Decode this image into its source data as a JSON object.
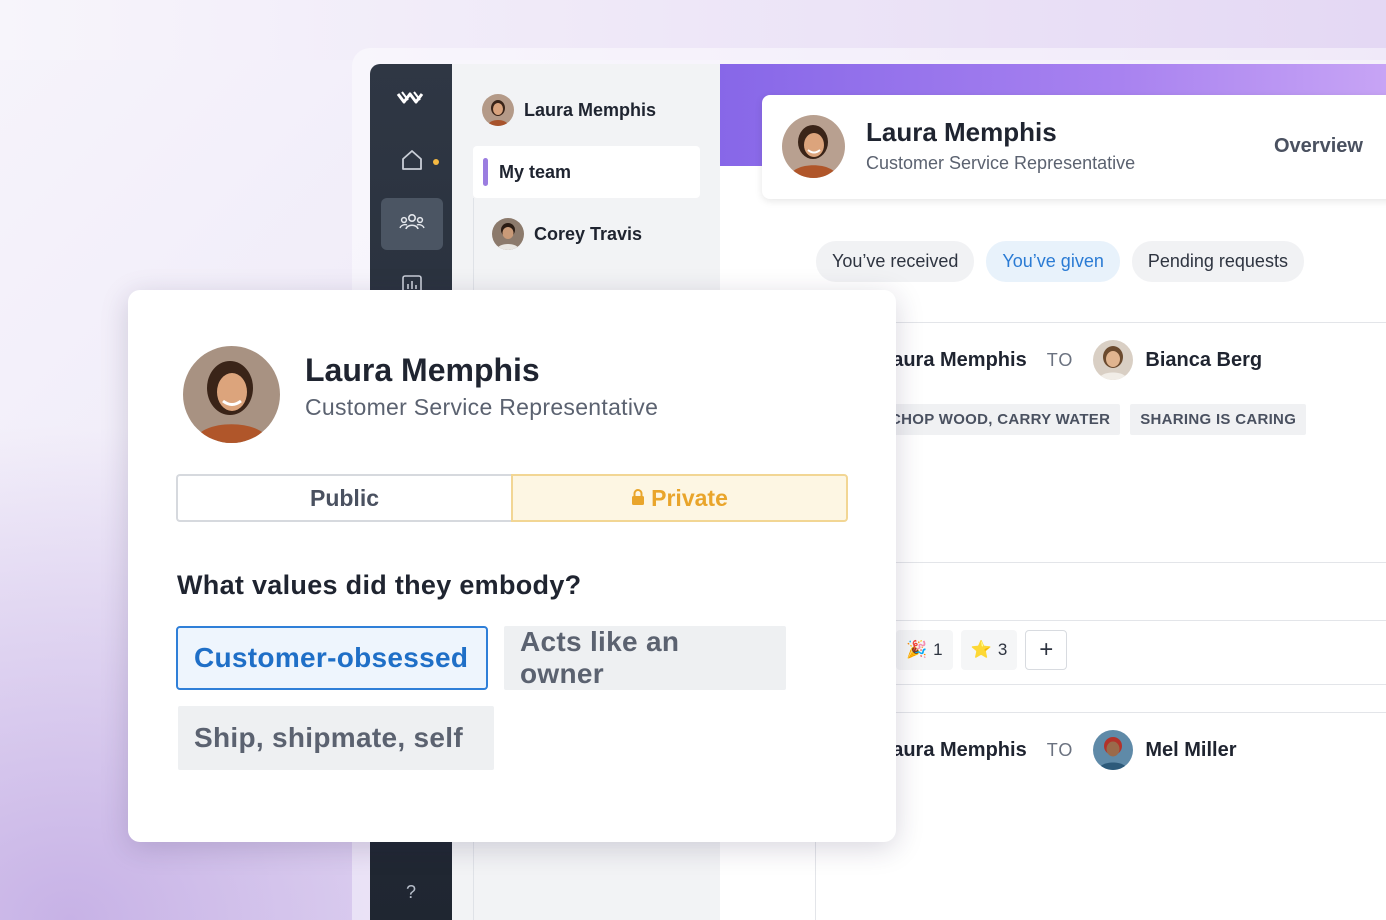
{
  "sidebar": {
    "logo": "≋",
    "help": "?"
  },
  "team": {
    "current_user": "Laura Memphis",
    "section": "My team",
    "members": [
      "Corey Travis"
    ]
  },
  "profile": {
    "name": "Laura Memphis",
    "role": "Customer Service Representative",
    "overview_label": "Overview"
  },
  "tabs": {
    "received": "You’ve received",
    "given": "You’ve given",
    "pending": "Pending requests"
  },
  "feed": [
    {
      "from": "Laura Memphis",
      "to_label": "TO",
      "recipient": "Bianca Berg",
      "tags": [
        "CHOP WOOD, CARRY WATER",
        "SHARING IS CARING"
      ],
      "reactions": [
        {
          "emoji": "🎉",
          "count": "1"
        },
        {
          "emoji": "⭐",
          "count": "3"
        }
      ],
      "add_label": "+"
    },
    {
      "from": "Laura Memphis",
      "to_label": "TO",
      "recipient": "Mel Miller"
    }
  ],
  "modal": {
    "name": "Laura Memphis",
    "role": "Customer Service Representative",
    "visibility": {
      "public": "Public",
      "private": "Private",
      "selected": "Private"
    },
    "question": "What values did they embody?",
    "values": [
      {
        "label": "Customer-obsessed",
        "selected": true
      },
      {
        "label": "Acts like an owner",
        "selected": false
      },
      {
        "label": "Ship, shipmate, self",
        "selected": false
      }
    ]
  },
  "colors": {
    "accent": "#2f7fd8",
    "private": "#e9a52b",
    "sidebar": "#2a313d",
    "header_gradient": "#8767e8"
  }
}
